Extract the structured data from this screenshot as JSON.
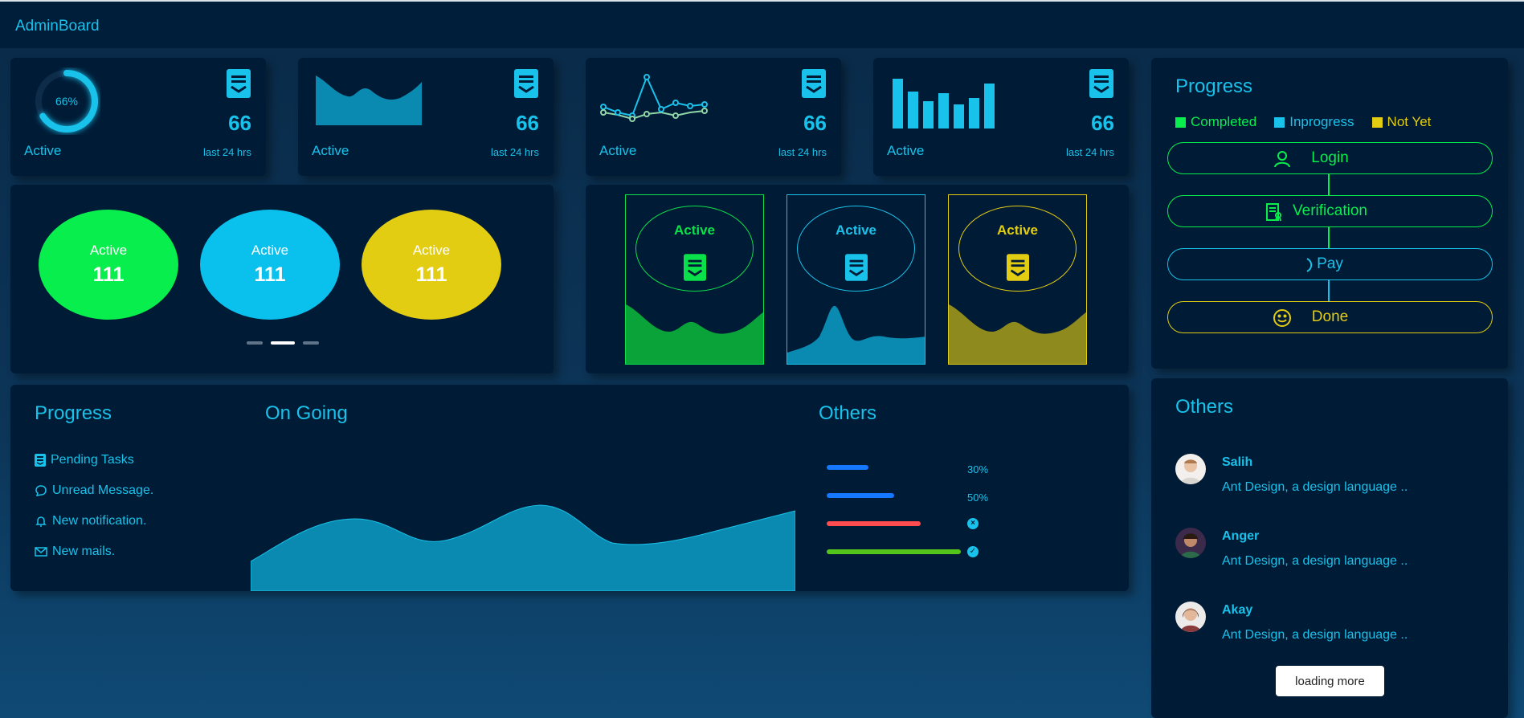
{
  "app": {
    "brand": "AdminBoard"
  },
  "kpis": [
    {
      "value": "66",
      "label": "Active",
      "sub": "last 24 hrs",
      "ring_text": "66%",
      "ring_fraction": 0.66
    },
    {
      "value": "66",
      "label": "Active",
      "sub": "last 24 hrs"
    },
    {
      "value": "66",
      "label": "Active",
      "sub": "last 24 hrs"
    },
    {
      "value": "66",
      "label": "Active",
      "sub": "last 24 hrs"
    }
  ],
  "bubbles": [
    {
      "label": "Active",
      "value": "111",
      "color": "#07ee4d"
    },
    {
      "label": "Active",
      "value": "111",
      "color": "#0ac1ed"
    },
    {
      "label": "Active",
      "value": "111",
      "color": "#e3cd13"
    }
  ],
  "carousel": {
    "count": 3,
    "active_index": 1
  },
  "panels": [
    {
      "title": "Active",
      "color": "#0ae04a",
      "fill": "#0aa33a"
    },
    {
      "title": "Active",
      "color": "#19c2ea",
      "fill": "#0a8ab0"
    },
    {
      "title": "Active",
      "color": "#e3cd13",
      "fill": "#8f8a1d"
    }
  ],
  "progress": {
    "title": "Progress",
    "legend": [
      {
        "label": "Completed",
        "color": "#07ee4d"
      },
      {
        "label": "Inprogress",
        "color": "#19c2ea"
      },
      {
        "label": "Not Yet",
        "color": "#e3cd13"
      }
    ],
    "steps": [
      {
        "label": "Login",
        "icon": "user-icon",
        "color": "#07ee4d"
      },
      {
        "label": "Verification",
        "icon": "certificate-icon",
        "color": "#07ee4d"
      },
      {
        "label": "Pay",
        "icon": "loading-icon",
        "color": "#19c2ea"
      },
      {
        "label": "Done",
        "icon": "smile-icon",
        "color": "#e3cd13"
      }
    ]
  },
  "bottom": {
    "progress_title": "Progress",
    "progress_items": [
      {
        "label": "Pending Tasks",
        "icon": "document-icon"
      },
      {
        "label": "Unread Message.",
        "icon": "chat-icon"
      },
      {
        "label": "New notification.",
        "icon": "bell-icon"
      },
      {
        "label": "New mails.",
        "icon": "mail-icon"
      }
    ],
    "ongoing_title": "On Going",
    "others_title": "Others",
    "others_bars": [
      {
        "fraction": 0.3,
        "color": "#1677ff",
        "label": "30%"
      },
      {
        "fraction": 0.5,
        "color": "#1677ff",
        "label": "50%"
      },
      {
        "fraction": 0.7,
        "color": "#ff4d4f",
        "status": "exception-icon"
      },
      {
        "fraction": 1.0,
        "color": "#52c41a",
        "status": "success-icon"
      }
    ]
  },
  "others": {
    "title": "Others",
    "people": [
      {
        "name": "Salih",
        "desc": "Ant Design, a design language .."
      },
      {
        "name": "Anger",
        "desc": "Ant Design, a design language .."
      },
      {
        "name": "Akay",
        "desc": "Ant Design, a design language .."
      }
    ],
    "load_more": "loading more"
  }
}
